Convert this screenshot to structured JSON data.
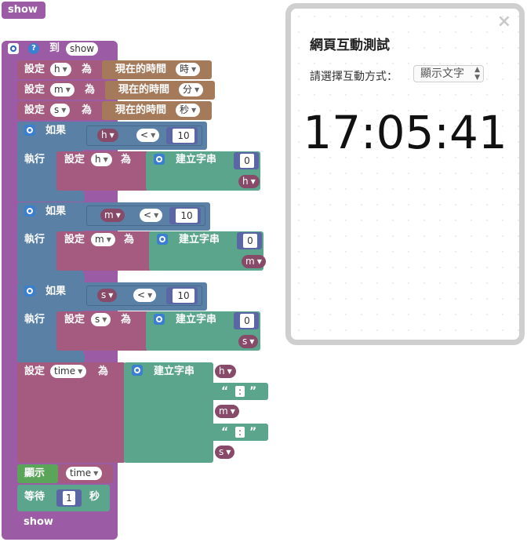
{
  "workspace": {
    "top_call_label": "show",
    "func_def": {
      "to_label": "到",
      "name": "show"
    },
    "set_label": "設定",
    "as_label": "為",
    "if_label": "如果",
    "do_label": "執行",
    "create_string_label": "建立字串",
    "current_time_label": "現在的時間",
    "var_h": "h",
    "var_m": "m",
    "var_s": "s",
    "var_time": "time",
    "unit_hour": "時",
    "unit_minute": "分",
    "unit_second": "秒",
    "compare_op": "<",
    "number_10": "10",
    "number_0": "0",
    "colon_text": ":",
    "display_label": "顯示",
    "wait_label": "等待",
    "wait_value": "1",
    "wait_unit": "秒",
    "call_show": "show"
  },
  "panel": {
    "close_symbol": "×",
    "title": "網頁互動測試",
    "prompt": "請選擇互動方式：",
    "select_value": "顯示文字",
    "clock_display": "17:05:41"
  },
  "colors": {
    "procedure": "#9b5ba5",
    "variable": "#a55b80",
    "logic": "#5b80a5",
    "text": "#5ba58c",
    "time": "#a57a5b",
    "math": "#5b67a5",
    "io": "#5ba55b"
  }
}
